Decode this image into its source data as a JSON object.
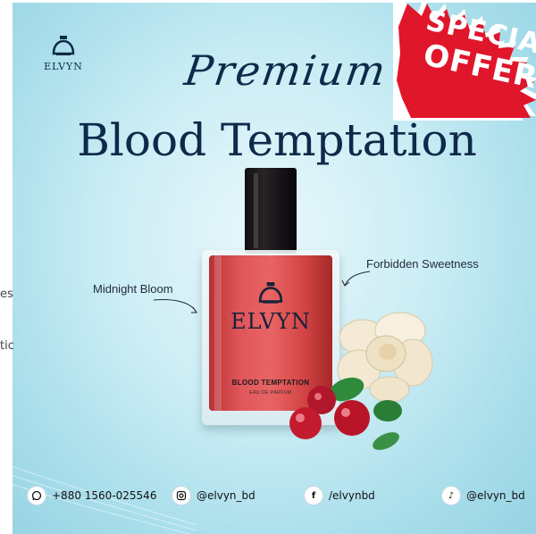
{
  "brand": "ELVYN",
  "heading": {
    "script": "Premium",
    "main": "Blood Temptation"
  },
  "badge": {
    "line1": "SPECIAL",
    "line2": "OFFER",
    "color": "#e0162b"
  },
  "bottle": {
    "brand": "ELVYN",
    "name": "BLOOD TEMPTATION",
    "type": "EAU DE PARFUM",
    "liquid_color": "#e05555",
    "cap_color": "#141414"
  },
  "notes": {
    "left": "Midnight Bloom",
    "right": "Forbidden Sweetness"
  },
  "contacts": [
    {
      "icon": "whatsapp-icon",
      "text": "+880 1560-025546"
    },
    {
      "icon": "instagram-icon",
      "text": "@elvyn_bd"
    },
    {
      "icon": "facebook-icon",
      "text": "/elvynbd"
    },
    {
      "icon": "tiktok-icon",
      "text": "@elvyn_bd"
    }
  ],
  "edge_fragments": [
    "es",
    "tic"
  ],
  "colors": {
    "background": "#bfe7f1",
    "title": "#0e2a4a"
  }
}
